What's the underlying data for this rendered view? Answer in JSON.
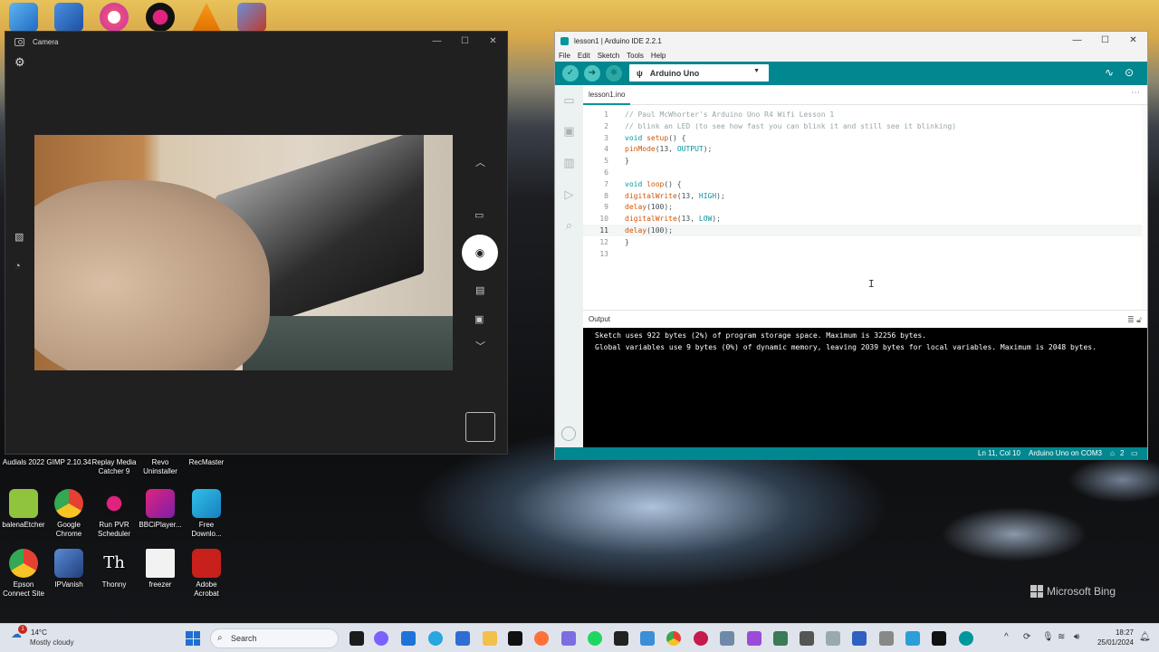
{
  "desktop": {
    "bing_label": "Microsoft Bing",
    "top_icons": [
      {
        "name": "control-panel"
      },
      {
        "name": "screen-app"
      },
      {
        "name": "itunes"
      },
      {
        "name": "pvr-app"
      },
      {
        "name": "vlc"
      },
      {
        "name": "setup-app"
      }
    ],
    "row_labels": [
      {
        "label": "Audials 2022"
      },
      {
        "label": "GIMP 2.10.34"
      },
      {
        "label": "Replay Media Catcher 9"
      },
      {
        "label": "Revo Uninstaller"
      },
      {
        "label": "RecMaster"
      }
    ],
    "icons_row2": [
      {
        "label": "balenaEtcher",
        "color": "#8fc43c"
      },
      {
        "label": "Google Chrome",
        "color": "#e44134"
      },
      {
        "label": "Run PVR Scheduler",
        "color": "#1a1a1a"
      },
      {
        "label": "BBCiPlayer...",
        "color": "#e0237e"
      },
      {
        "label": "Free Downlo...",
        "color": "#20a8d8"
      }
    ],
    "icons_row3": [
      {
        "label": "Epson Connect Site",
        "color": "#e44134"
      },
      {
        "label": "IPVanish",
        "color": "#3b6ab5"
      },
      {
        "label": "Thonny",
        "color": "#dcdcdc"
      },
      {
        "label": "freezer",
        "color": "#f2f2f2"
      },
      {
        "label": "Adobe Acrobat",
        "color": "#c8201a"
      }
    ]
  },
  "camera": {
    "title": "Camera",
    "controls": {
      "minimize": "—",
      "maximize": "☐",
      "close": "✕"
    }
  },
  "arduino": {
    "title": "lesson1 | Arduino IDE 2.2.1",
    "controls": {
      "minimize": "—",
      "maximize": "☐",
      "close": "✕"
    },
    "menu": [
      "File",
      "Edit",
      "Sketch",
      "Tools",
      "Help"
    ],
    "board": "Arduino Uno",
    "tab": "lesson1.ino",
    "active_line": 11,
    "code": [
      {
        "n": "1",
        "text": "// Paul McWhorter's Arduino Uno R4 Wifi Lesson 1",
        "kind": "comment"
      },
      {
        "n": "2",
        "text": "// blink an LED (to see how fast you can blink it and still see it blinking)",
        "kind": "comment"
      },
      {
        "n": "3",
        "text": "void setup() {",
        "kind": "code"
      },
      {
        "n": "4",
        "text": "pinMode(13, OUTPUT);",
        "kind": "code"
      },
      {
        "n": "5",
        "text": "}",
        "kind": "code"
      },
      {
        "n": "6",
        "text": "",
        "kind": "code"
      },
      {
        "n": "7",
        "text": "void loop() {",
        "kind": "code"
      },
      {
        "n": "8",
        "text": "digitalWrite(13, HIGH);",
        "kind": "code"
      },
      {
        "n": "9",
        "text": "delay(100);",
        "kind": "code"
      },
      {
        "n": "10",
        "text": "digitalWrite(13, LOW);",
        "kind": "code"
      },
      {
        "n": "11",
        "text": "delay(100);",
        "kind": "code"
      },
      {
        "n": "12",
        "text": "}",
        "kind": "code"
      },
      {
        "n": "13",
        "text": "",
        "kind": "code"
      }
    ],
    "output_title": "Output",
    "output_lines": [
      "Sketch uses 922 bytes (2%) of program storage space. Maximum is 32256 bytes.",
      "Global variables use 9 bytes (0%) of dynamic memory, leaving 2039 bytes for local variables. Maximum is 2048 bytes."
    ],
    "status": {
      "position": "Ln 11, Col 10",
      "board_port": "Arduino Uno on COM3",
      "notifications": "2"
    }
  },
  "taskbar": {
    "weather_temp": "14°C",
    "weather_cond": "Mostly cloudy",
    "weather_badge": "1",
    "search_placeholder": "Search",
    "time": "18:27",
    "date": "25/01/2024"
  },
  "colors": {
    "arduino_teal": "#00878f",
    "arduino_accent": "#00979c"
  }
}
